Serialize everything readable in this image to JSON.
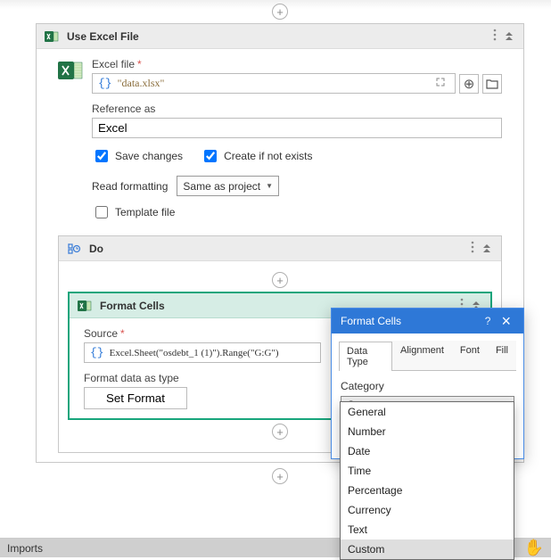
{
  "outer_activity": {
    "title": "Use Excel File",
    "excel_file_label": "Excel file",
    "excel_file_value": "\"data.xlsx\"",
    "reference_label": "Reference as",
    "reference_value": "Excel",
    "save_changes_label": "Save changes",
    "create_if_label": "Create if not exists",
    "read_fmt_label": "Read formatting",
    "read_fmt_value": "Same as project",
    "template_label": "Template file"
  },
  "do_activity": {
    "title": "Do",
    "format_cells": {
      "title": "Format Cells",
      "source_label": "Source",
      "source_value": "Excel.Sheet(\"osdebt_1 (1)\").Range(\"G:G\")",
      "format_as_label": "Format data as type",
      "set_format_btn": "Set Format"
    }
  },
  "popup": {
    "title": "Format Cells",
    "tabs": [
      "Data Type",
      "Alignment",
      "Font",
      "Fill"
    ],
    "active_tab_index": 0,
    "category_label": "Category",
    "selected_category": "Custom",
    "options": [
      "General",
      "Number",
      "Date",
      "Time",
      "Percentage",
      "Currency",
      "Text",
      "Custom"
    ]
  },
  "footer": {
    "imports": "Imports"
  }
}
